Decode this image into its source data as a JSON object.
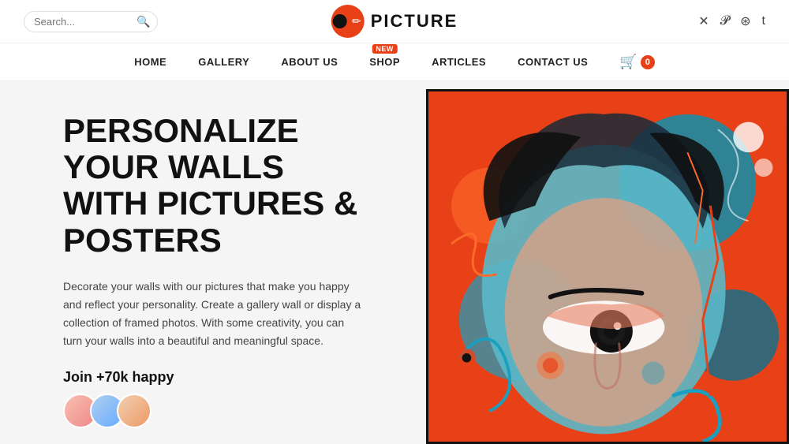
{
  "header": {
    "search_placeholder": "Search...",
    "logo_text": "PICTURE",
    "social_icons": [
      {
        "name": "twitter-icon",
        "symbol": "✕"
      },
      {
        "name": "pinterest-icon",
        "symbol": "𝓟"
      },
      {
        "name": "settings-icon",
        "symbol": "⊛"
      },
      {
        "name": "tumblr-icon",
        "symbol": "t"
      }
    ]
  },
  "nav": {
    "items": [
      {
        "label": "HOME",
        "name": "nav-home"
      },
      {
        "label": "GALLERY",
        "name": "nav-gallery"
      },
      {
        "label": "ABOUT US",
        "name": "nav-about"
      },
      {
        "label": "SHOP",
        "name": "nav-shop",
        "badge": "NEW"
      },
      {
        "label": "ARTICLES",
        "name": "nav-articles"
      },
      {
        "label": "CONTACT US",
        "name": "nav-contact"
      }
    ],
    "cart_count": "0"
  },
  "hero": {
    "title": "PERSONALIZE YOUR WALLS WITH PICTURES & POSTERS",
    "description": "Decorate your walls with our pictures that make you happy and reflect your personality. Create a gallery wall or display a collection of framed photos. With some creativity, you can turn your walls into a beautiful and meaningful space.",
    "join_text": "Join +70k happy"
  }
}
